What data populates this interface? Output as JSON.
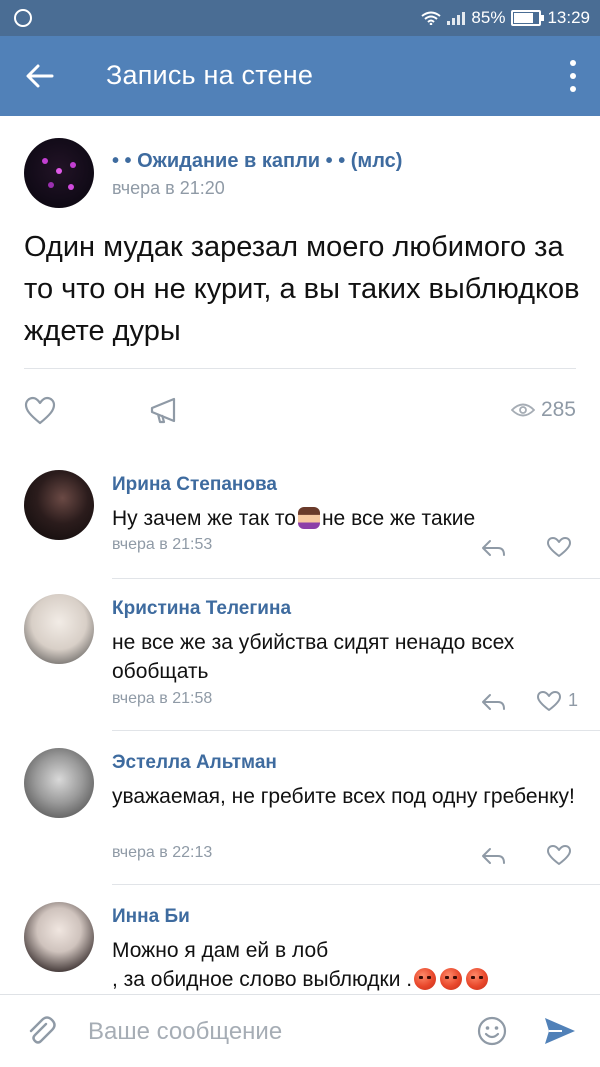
{
  "status_bar": {
    "battery": "85%",
    "time": "13:29",
    "battery_level": 0.85
  },
  "app_bar": {
    "title": "Запись на стене"
  },
  "post": {
    "author": "• • Ожидание в капли • • (млс)",
    "time": "вчера в 21:20",
    "text": "Один мудак зарезал моего любимого за то что он не курит, а вы таких выблюдков ждете дуры",
    "views": "285"
  },
  "comments": [
    {
      "name": "Ирина Степанова",
      "text_before": "Ну зачем же так то",
      "text_after": "не все же такие",
      "time": "вчера в 21:53",
      "likes": ""
    },
    {
      "name": "Кристина Телегина",
      "text": "не все же за убийства сидят ненадо всех обобщать",
      "time": "вчера в 21:58",
      "likes": "1"
    },
    {
      "name": "Эстелла Альтман",
      "text": "уважаемая, не гребите всех под одну гребенку!",
      "time": "вчера в 22:13",
      "likes": ""
    },
    {
      "name": "Инна Би",
      "text_line1": "Можно я дам ей в лоб",
      "text_line2": ", за обидное слово выблюдки ."
    }
  ],
  "composer": {
    "placeholder": "Ваше сообщение"
  },
  "colors": {
    "status_bar": "#4a6d94",
    "app_bar": "#5181b8",
    "link": "#3e6b9f",
    "meta": "#8f9aa6"
  },
  "icons": [
    "back-arrow-icon",
    "more-vert-icon",
    "heart-icon",
    "share-icon",
    "eye-icon",
    "reply-icon",
    "paperclip-icon",
    "smile-icon",
    "send-icon",
    "wifi-icon",
    "signal-icon",
    "battery-icon",
    "settings-icon"
  ]
}
